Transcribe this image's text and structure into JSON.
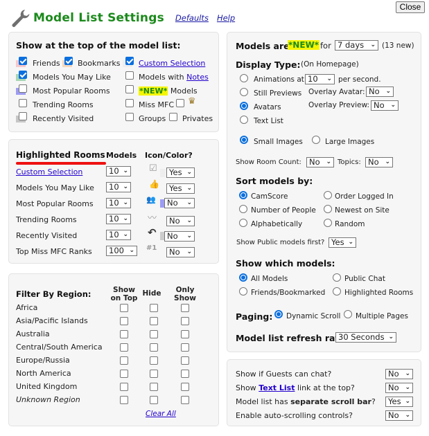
{
  "header": {
    "title": "Model List Settings",
    "defaults_link": "Defaults",
    "help_link": "Help",
    "close_button": "Close"
  },
  "show_top": {
    "heading": "Show at the top of the model list:",
    "items": [
      {
        "label": "Friends",
        "checked": true,
        "swatch": "#f6c9cc"
      },
      {
        "label": "Bookmarks",
        "checked": true,
        "swatch": "#f5d8bd"
      },
      {
        "label": "Custom Selection",
        "checked": true,
        "link": true
      },
      {
        "label": "Models You May Like",
        "checked": true,
        "swatch": "#a8d6b3"
      },
      {
        "label_prefix": "Models with ",
        "label_link": "Notes",
        "checked": false
      },
      {
        "label": "Most Popular Rooms",
        "checked": false,
        "swatch": "#9d9cf3"
      },
      {
        "label_new": "*NEW*",
        "label": "Models",
        "checked": false
      },
      {
        "label": "Trending Rooms",
        "checked": false
      },
      {
        "label": "Miss MFC",
        "checked": false
      },
      {
        "label": "crown",
        "checked": false,
        "icon": "crown-icon"
      },
      {
        "label": "Recently Visited",
        "checked": false,
        "swatch": "#c6c6c6"
      },
      {
        "label": "Groups",
        "checked": false
      },
      {
        "label": "Privates",
        "checked": false
      }
    ]
  },
  "highlighted": {
    "heading": "Highlighted Rooms",
    "col_models": "Models",
    "col_icon": "Icon/Color?",
    "rows": [
      {
        "label": "Custom Selection",
        "link": true,
        "models": "10",
        "icon": "checkbox-icon",
        "icon_glyph": "☑",
        "swatch": "#eeeeee",
        "color": "Yes"
      },
      {
        "label": "Models You May Like",
        "models": "10",
        "icon": "thumbs-up-icon",
        "icon_glyph": "👍",
        "swatch": "",
        "color": "Yes"
      },
      {
        "label": "Most Popular Rooms",
        "models": "10",
        "icon": "group-icon",
        "icon_glyph": "👥",
        "swatch": "#9d9cf3",
        "color": "No"
      },
      {
        "label": "Trending Rooms",
        "models": "10",
        "icon": "trending-icon",
        "icon_glyph": "↗",
        "swatch": "",
        "color": "No"
      },
      {
        "label": "Recently Visited",
        "models": "10",
        "icon": "return-arrow-icon",
        "icon_glyph": "↶",
        "swatch": "#cccccc",
        "color": "No"
      },
      {
        "label": "Top Miss MFC Ranks",
        "models": "100",
        "icon": "rank-icon",
        "icon_glyph": "#1",
        "swatch": "",
        "color": "No"
      }
    ]
  },
  "region": {
    "heading": "Filter By Region:",
    "col_show_on_top": [
      "Show",
      "on Top"
    ],
    "col_hide": "Hide",
    "col_only_show": [
      "Only",
      "Show"
    ],
    "rows": [
      {
        "label": "Africa"
      },
      {
        "label": "Asia/Pacific Islands"
      },
      {
        "label": "Australia"
      },
      {
        "label": "Central/South America"
      },
      {
        "label": "Europe/Russia"
      },
      {
        "label": "North America"
      },
      {
        "label": "United Kingdom"
      },
      {
        "label": "Unknown Region",
        "italic": true
      }
    ],
    "clear_all": "Clear All"
  },
  "display": {
    "new_prefix": "Models are",
    "new_badge": "*NEW*",
    "new_for": "for",
    "new_days": "7 days",
    "new_count": "(13 new)",
    "display_type_heading": "Display Type:",
    "display_type_note": "(On Homepage)",
    "animations_label": "Animations at",
    "animations_rate": "10",
    "per_second": "per second.",
    "still_previews": "Still Previews",
    "overlay_avatar_label": "Overlay Avatar:",
    "overlay_avatar_value": "No",
    "avatars": "Avatars",
    "overlay_preview_label": "Overlay Preview:",
    "overlay_preview_value": "No",
    "text_list": "Text List",
    "selected_display": "Avatars",
    "small_images": "Small Images",
    "large_images": "Large Images",
    "selected_size": "Small Images",
    "room_count_label": "Show Room Count:",
    "room_count_value": "No",
    "topics_label": "Topics:",
    "topics_value": "No",
    "sort_heading": "Sort models by:",
    "sort_options": [
      "CamScore",
      "Order Logged In",
      "Number of People",
      "Newest on Site",
      "Alphabetically",
      "Random"
    ],
    "sort_selected": "CamScore",
    "public_first_label": "Show Public models first?",
    "public_first_value": "Yes",
    "which_heading": "Show which models:",
    "which_options": [
      "All Models",
      "Public Chat",
      "Friends/Bookmarked",
      "Highlighted Rooms"
    ],
    "which_selected": "All Models",
    "paging_label": "Paging:",
    "paging_options": [
      "Dynamic Scroll",
      "Multiple Pages"
    ],
    "paging_selected": "Dynamic Scroll",
    "refresh_label": "Model list refresh rate:",
    "refresh_value": "30 Seconds"
  },
  "misc": {
    "guests_chat_label": "Show if Guests can chat?",
    "guests_chat_value": "No",
    "text_list_prefix": "Show ",
    "text_list_link": "Text List",
    "text_list_suffix": " link at the top?",
    "text_list_value": "No",
    "scroll_prefix": "Model list has ",
    "scroll_bold": "separate scroll bar",
    "scroll_suffix": "?",
    "scroll_value": "Yes",
    "autoscroll_label": "Enable auto-scrolling controls?",
    "autoscroll_value": "No"
  }
}
